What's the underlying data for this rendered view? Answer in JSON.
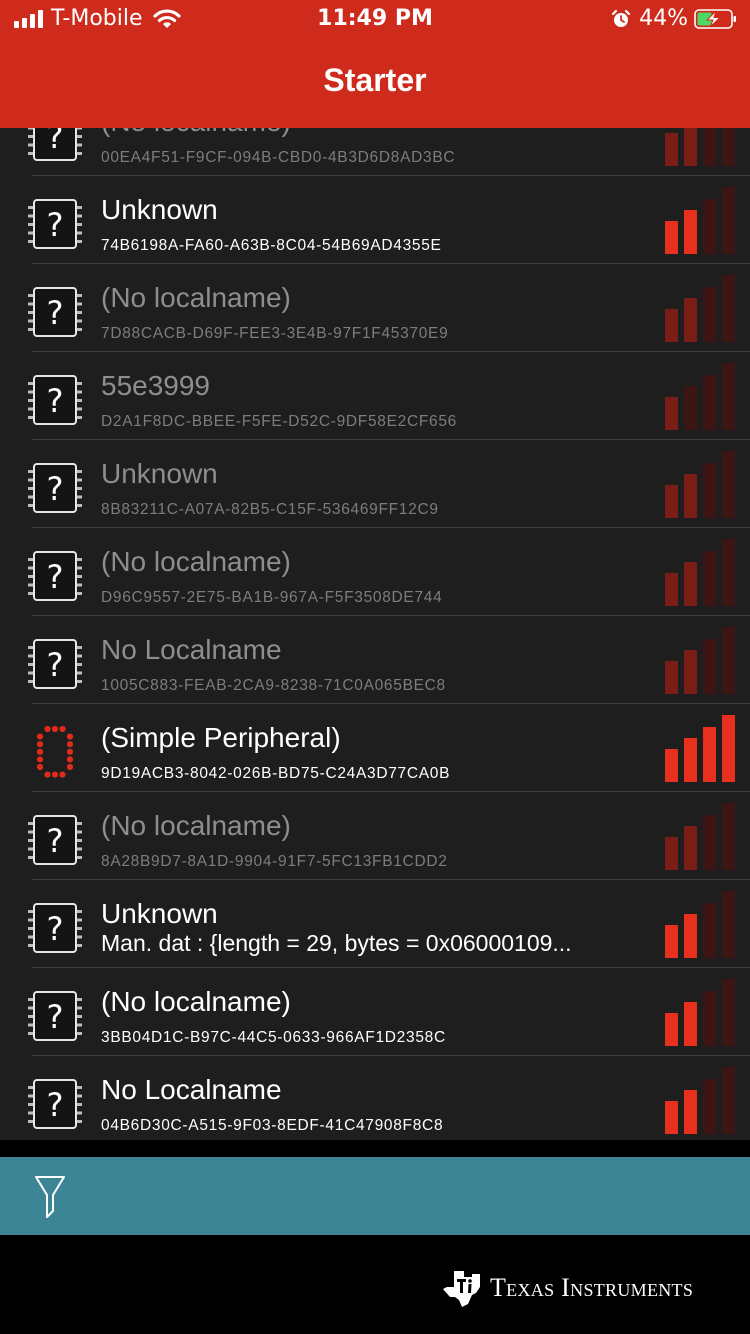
{
  "status_bar": {
    "carrier": "T-Mobile",
    "time": "11:49 PM",
    "battery_percent": "44%",
    "signal_bars": 4,
    "battery_level": 0.44,
    "charging": true
  },
  "nav": {
    "title": "Starter"
  },
  "colors": {
    "header_red": "#cf2b1d",
    "list_background": "#1e1e1e",
    "toolbar_teal": "#3c8594",
    "rssi_bright": "#e8301f",
    "rssi_dim": "#7a1d16",
    "rssi_faint": "#3d1613"
  },
  "devices": [
    {
      "name": "(No localname)",
      "identifier": "00EA4F51-F9CF-094B-CBD0-4B3D6D8AD3BC",
      "icon": "question-chip-icon",
      "active": false,
      "rssi_bars": 2
    },
    {
      "name": "Unknown",
      "identifier": "74B6198A-FA60-A63B-8C04-54B69AD4355E",
      "icon": "question-chip-icon",
      "active": true,
      "rssi_bars": 2
    },
    {
      "name": "(No localname)",
      "identifier": "7D88CACB-D69F-FEE3-3E4B-97F1F45370E9",
      "icon": "question-chip-icon",
      "active": false,
      "rssi_bars": 2
    },
    {
      "name": "55e3999",
      "identifier": "D2A1F8DC-BBEE-F5FE-D52C-9DF58E2CF656",
      "icon": "question-chip-icon",
      "active": false,
      "rssi_bars": 1
    },
    {
      "name": "Unknown",
      "identifier": "8B83211C-A07A-82B5-C15F-536469FF12C9",
      "icon": "question-chip-icon",
      "active": false,
      "rssi_bars": 2
    },
    {
      "name": "(No localname)",
      "identifier": "D96C9557-2E75-BA1B-967A-F5F3508DE744",
      "icon": "question-chip-icon",
      "active": false,
      "rssi_bars": 2
    },
    {
      "name": "No Localname",
      "identifier": "1005C883-FEAB-2CA9-8238-71C0A065BEC8",
      "icon": "question-chip-icon",
      "active": false,
      "rssi_bars": 2
    },
    {
      "name": "(Simple Peripheral)",
      "identifier": "9D19ACB3-8042-026B-BD75-C24A3D77CA0B",
      "icon": "led-zero-icon",
      "active": true,
      "rssi_bars": 4
    },
    {
      "name": "(No localname)",
      "identifier": "8A28B9D7-8A1D-9904-91F7-5FC13FB1CDD2",
      "icon": "question-chip-icon",
      "active": false,
      "rssi_bars": 2
    },
    {
      "name": "Unknown",
      "identifier": "Man. dat : {length = 29, bytes = 0x06000109...",
      "icon": "question-chip-icon",
      "active": true,
      "rssi_bars": 2,
      "manufacturer_data": true
    },
    {
      "name": "(No localname)",
      "identifier": "3BB04D1C-B97C-44C5-0633-966AF1D2358C",
      "icon": "question-chip-icon",
      "active": true,
      "rssi_bars": 2
    },
    {
      "name": "No Localname",
      "identifier": "04B6D30C-A515-9F03-8EDF-41C47908F8C8",
      "icon": "question-chip-icon",
      "active": true,
      "rssi_bars": 2
    }
  ],
  "toolbar": {
    "filter_icon": "filter-icon"
  },
  "footer": {
    "logo_icon": "texas-instruments-logo-icon",
    "brand_text": "Texas Instruments"
  }
}
